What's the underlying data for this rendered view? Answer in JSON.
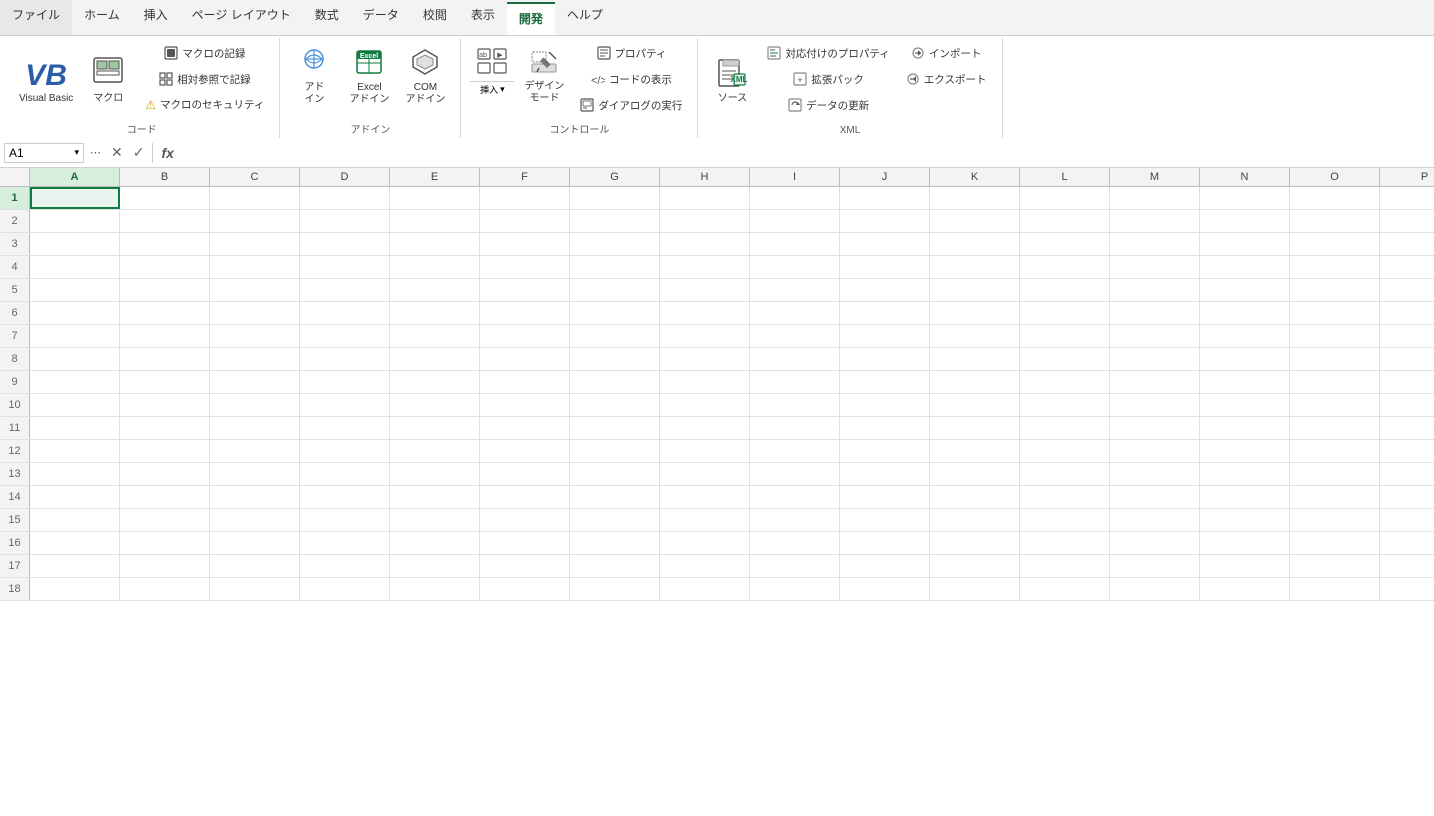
{
  "ribbon": {
    "tabs": [
      {
        "id": "file",
        "label": "ファイル",
        "active": false
      },
      {
        "id": "home",
        "label": "ホーム",
        "active": false
      },
      {
        "id": "insert",
        "label": "挿入",
        "active": false
      },
      {
        "id": "pagelayout",
        "label": "ページ レイアウト",
        "active": false
      },
      {
        "id": "formulas",
        "label": "数式",
        "active": false
      },
      {
        "id": "data",
        "label": "データ",
        "active": false
      },
      {
        "id": "review",
        "label": "校閲",
        "active": false
      },
      {
        "id": "view",
        "label": "表示",
        "active": false
      },
      {
        "id": "developer",
        "label": "開発",
        "active": true
      },
      {
        "id": "help",
        "label": "ヘルプ",
        "active": false
      }
    ],
    "groups": {
      "code": {
        "label": "コード",
        "buttons": [
          {
            "id": "visual-basic",
            "label": "Visual Basic",
            "type": "large"
          },
          {
            "id": "macro",
            "label": "マクロ",
            "type": "large"
          },
          {
            "id": "record-macro",
            "label": "マクロの記録",
            "type": "small"
          },
          {
            "id": "relative-ref",
            "label": "相対参照で記録",
            "type": "small"
          },
          {
            "id": "macro-security",
            "label": "マクロのセキュリティ",
            "type": "small"
          }
        ]
      },
      "addin": {
        "label": "アドイン",
        "buttons": [
          {
            "id": "addin",
            "label": "アドイン",
            "type": "large"
          },
          {
            "id": "excel-addin",
            "label": "Excel\nアドイン",
            "type": "large"
          },
          {
            "id": "com-addin",
            "label": "COM\nアドイン",
            "type": "large"
          }
        ]
      },
      "controls": {
        "label": "コントロール",
        "buttons": [
          {
            "id": "insert-control",
            "label": "挿入",
            "type": "large-split"
          },
          {
            "id": "design-mode",
            "label": "デザイン\nモード",
            "type": "large"
          },
          {
            "id": "properties",
            "label": "プロパティ",
            "type": "small"
          },
          {
            "id": "view-code",
            "label": "コードの表示",
            "type": "small"
          },
          {
            "id": "run-dialog",
            "label": "ダイアログの実行",
            "type": "small"
          }
        ]
      },
      "xml": {
        "label": "XML",
        "buttons": [
          {
            "id": "source",
            "label": "ソース",
            "type": "large"
          },
          {
            "id": "map-properties",
            "label": "対応付けのプロパティ",
            "type": "small"
          },
          {
            "id": "expansion-pack",
            "label": "拡張パック",
            "type": "small"
          },
          {
            "id": "refresh-data",
            "label": "データの更新",
            "type": "small"
          },
          {
            "id": "import",
            "label": "インポート",
            "type": "small"
          },
          {
            "id": "export",
            "label": "エクスポート",
            "type": "small"
          }
        ]
      }
    }
  },
  "formula_bar": {
    "cell_ref": "A1",
    "formula_content": ""
  },
  "columns": [
    "A",
    "B",
    "C",
    "D",
    "E",
    "F",
    "G",
    "H",
    "I",
    "J",
    "K",
    "L",
    "M",
    "N",
    "O",
    "P"
  ],
  "rows": [
    1,
    2,
    3,
    4,
    5,
    6,
    7,
    8,
    9,
    10,
    11,
    12,
    13,
    14,
    15,
    16,
    17,
    18
  ],
  "active_cell": {
    "col": "A",
    "row": 1
  },
  "icons": {
    "visual_basic": "VB",
    "macro": "▦",
    "record": "⏺",
    "relative": "⊞",
    "security": "⚠",
    "addin": "◈",
    "excel_addin": "⊞",
    "com_addin": "⬡",
    "insert": "⊞",
    "design": "✏",
    "properties": "☰",
    "view_code": "<>",
    "dialog": "▣",
    "source": "≋",
    "map_props": "⊟",
    "expansion": "⊞",
    "refresh": "⟳",
    "import": "→",
    "export": "←",
    "chevron_down": "▾",
    "cancel": "✕",
    "confirm": "✓",
    "fx": "fx"
  }
}
